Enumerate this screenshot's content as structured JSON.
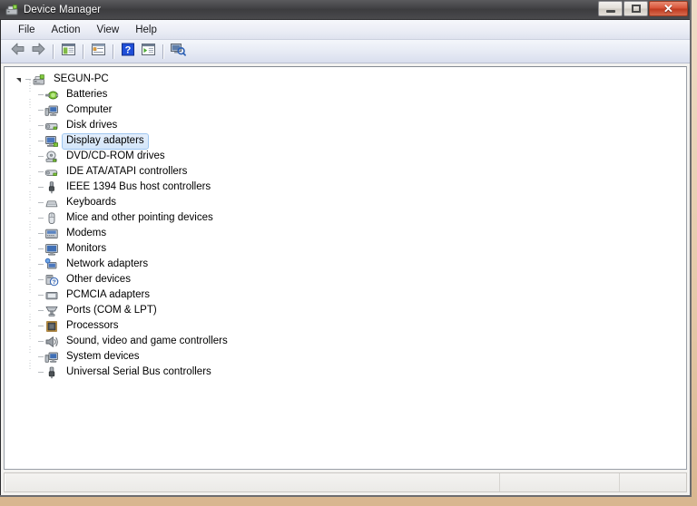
{
  "window": {
    "title": "Device Manager",
    "title_icon": "device-manager-icon",
    "controls": {
      "minimize": "Minimize",
      "maximize": "Maximize",
      "close": "Close",
      "close_glyph": "✕"
    }
  },
  "menubar": {
    "items": [
      {
        "label": "File",
        "name": "menu-file"
      },
      {
        "label": "Action",
        "name": "menu-action"
      },
      {
        "label": "View",
        "name": "menu-view"
      },
      {
        "label": "Help",
        "name": "menu-help"
      }
    ]
  },
  "toolbar": {
    "buttons": [
      {
        "name": "back-button",
        "icon": "back-arrow-icon",
        "title": "Back"
      },
      {
        "name": "forward-button",
        "icon": "forward-arrow-icon",
        "title": "Forward"
      },
      {
        "name": "show-hide-tree-button",
        "icon": "console-tree-icon",
        "title": "Show/Hide Console Tree"
      },
      {
        "name": "properties-button",
        "icon": "properties-icon",
        "title": "Properties"
      },
      {
        "name": "help-button",
        "icon": "help-question-icon",
        "title": "Help"
      },
      {
        "name": "scan-hardware-button",
        "icon": "scan-hardware-icon",
        "title": "Scan for hardware changes"
      },
      {
        "name": "update-driver-button",
        "icon": "update-driver-icon",
        "title": "Update Driver Software"
      }
    ]
  },
  "tree": {
    "root": {
      "label": "SEGUN-PC",
      "icon": "computer-root-icon",
      "expanded": true,
      "name": "tree-node-segun-pc"
    },
    "nodes": [
      {
        "label": "Batteries",
        "icon": "batteries-icon",
        "name": "tree-node-batteries",
        "selected": false
      },
      {
        "label": "Computer",
        "icon": "computer-icon",
        "name": "tree-node-computer",
        "selected": false
      },
      {
        "label": "Disk drives",
        "icon": "disk-drive-icon",
        "name": "tree-node-disk-drives",
        "selected": false
      },
      {
        "label": "Display adapters",
        "icon": "display-adapter-icon",
        "name": "tree-node-display-adapters",
        "selected": true
      },
      {
        "label": "DVD/CD-ROM drives",
        "icon": "dvd-cdrom-icon",
        "name": "tree-node-dvd-cdrom-drives",
        "selected": false
      },
      {
        "label": "IDE ATA/ATAPI controllers",
        "icon": "ide-controller-icon",
        "name": "tree-node-ide-controllers",
        "selected": false
      },
      {
        "label": "IEEE 1394 Bus host controllers",
        "icon": "ieee1394-icon",
        "name": "tree-node-ieee1394",
        "selected": false
      },
      {
        "label": "Keyboards",
        "icon": "keyboard-icon",
        "name": "tree-node-keyboards",
        "selected": false
      },
      {
        "label": "Mice and other pointing devices",
        "icon": "mouse-icon",
        "name": "tree-node-mice",
        "selected": false
      },
      {
        "label": "Modems",
        "icon": "modem-icon",
        "name": "tree-node-modems",
        "selected": false
      },
      {
        "label": "Monitors",
        "icon": "monitor-icon",
        "name": "tree-node-monitors",
        "selected": false
      },
      {
        "label": "Network adapters",
        "icon": "network-adapter-icon",
        "name": "tree-node-network-adapters",
        "selected": false
      },
      {
        "label": "Other devices",
        "icon": "other-devices-icon",
        "name": "tree-node-other-devices",
        "selected": false
      },
      {
        "label": "PCMCIA adapters",
        "icon": "pcmcia-icon",
        "name": "tree-node-pcmcia-adapters",
        "selected": false
      },
      {
        "label": "Ports (COM & LPT)",
        "icon": "ports-icon",
        "name": "tree-node-ports",
        "selected": false
      },
      {
        "label": "Processors",
        "icon": "processor-icon",
        "name": "tree-node-processors",
        "selected": false
      },
      {
        "label": "Sound, video and game controllers",
        "icon": "sound-icon",
        "name": "tree-node-sound",
        "selected": false
      },
      {
        "label": "System devices",
        "icon": "system-devices-icon",
        "name": "tree-node-system-devices",
        "selected": false
      },
      {
        "label": "Universal Serial Bus controllers",
        "icon": "usb-icon",
        "name": "tree-node-usb-controllers",
        "selected": false
      }
    ]
  },
  "statusbar": {
    "panes": [
      {
        "text": "",
        "name": "status-pane-main"
      },
      {
        "text": "",
        "name": "status-pane-second"
      },
      {
        "text": "",
        "name": "status-pane-third"
      }
    ]
  },
  "colors": {
    "titlebar": "#454548",
    "close_button": "#d9553a",
    "selection_fill": "#d4e6fa",
    "selection_border": "#9ec6f0",
    "panel_background": "#ffffff",
    "desktop": "#e6c9a8"
  }
}
